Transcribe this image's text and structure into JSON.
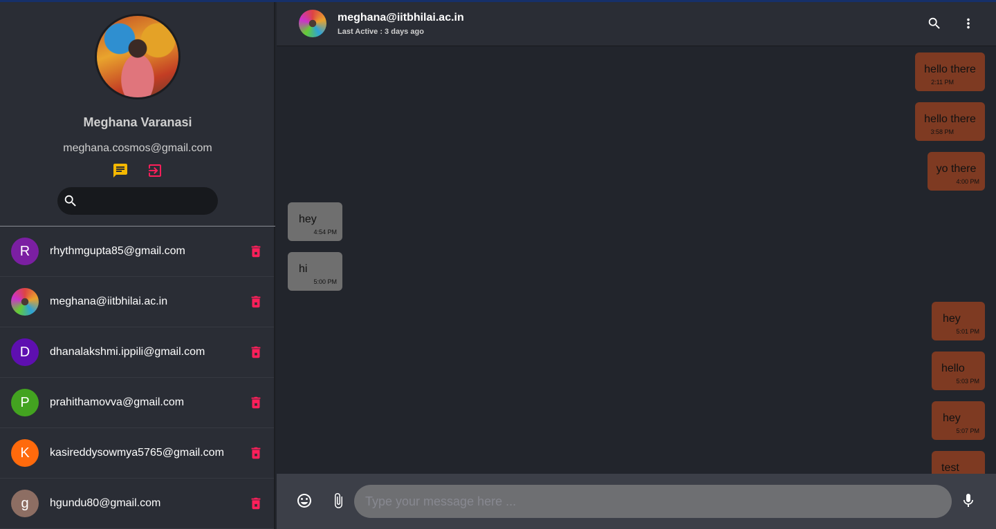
{
  "profile": {
    "name": "Meghana Varanasi",
    "email": "meghana.cosmos@gmail.com",
    "search_placeholder": ""
  },
  "contacts": [
    {
      "initial": "R",
      "email": "rhythmgupta85@gmail.com",
      "color": "#7b1fa2"
    },
    {
      "initial": "",
      "email": "meghana@iitbhilai.ac.in",
      "color": "#444"
    },
    {
      "initial": "D",
      "email": "dhanalakshmi.ippili@gmail.com",
      "color": "#5e0fb0"
    },
    {
      "initial": "P",
      "email": "prahithamovva@gmail.com",
      "color": "#43a320"
    },
    {
      "initial": "K",
      "email": "kasireddysowmya5765@gmail.com",
      "color": "#ff6a0c"
    },
    {
      "initial": "g",
      "email": "hgundu80@gmail.com",
      "color": "#8d6e63"
    }
  ],
  "chat": {
    "title": "meghana@iitbhilai.ac.in",
    "subtitle": "Last Active : 3 days ago",
    "messages": [
      {
        "text": "hello there",
        "time": "2:11 PM",
        "dir": "sent"
      },
      {
        "text": "hello there",
        "time": "3:58 PM",
        "dir": "sent"
      },
      {
        "text": "yo there",
        "time": "4:00 PM",
        "dir": "sent"
      },
      {
        "text": "hey",
        "time": "4:54 PM",
        "dir": "recv"
      },
      {
        "text": "hi",
        "time": "5:00 PM",
        "dir": "recv"
      },
      {
        "text": "hey",
        "time": "5:01 PM",
        "dir": "sent"
      },
      {
        "text": "hello",
        "time": "5:03 PM",
        "dir": "sent"
      },
      {
        "text": "hey",
        "time": "5:07 PM",
        "dir": "sent"
      },
      {
        "text": "test",
        "time": "",
        "dir": "sent"
      }
    ]
  },
  "composer": {
    "placeholder": "Type your message here ..."
  },
  "colors": {
    "accent_yellow": "#f5b800",
    "accent_pink": "#ff1f5a",
    "sent_bubble": "#7e3a22",
    "recv_bubble": "#6f6f6f"
  }
}
